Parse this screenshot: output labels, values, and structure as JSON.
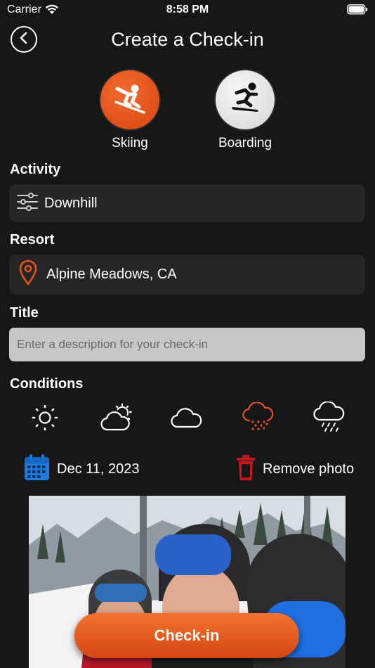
{
  "status": {
    "carrier": "Carrier",
    "time": "8:58 PM"
  },
  "nav": {
    "title": "Create a Check-in"
  },
  "sports": [
    {
      "label": "Skiing",
      "selected": true
    },
    {
      "label": "Boarding",
      "selected": false
    }
  ],
  "activity": {
    "label": "Activity",
    "value": "Downhill"
  },
  "resort": {
    "label": "Resort",
    "value": "Alpine Meadows, CA"
  },
  "title_field": {
    "label": "Title",
    "placeholder": "Enter a description for your check-in",
    "value": ""
  },
  "conditions": {
    "label": "Conditions",
    "options": [
      "sunny-icon",
      "partly-cloudy-icon",
      "cloudy-icon",
      "snow-icon",
      "rain-icon"
    ],
    "selected": "snow-icon"
  },
  "date": {
    "value": "Dec 11, 2023"
  },
  "remove_photo": {
    "label": "Remove photo"
  },
  "checkin_button": {
    "label": "Check-in"
  },
  "colors": {
    "accent": "#E5531A",
    "background": "#171717",
    "field": "#262626",
    "date_icon": "#1E7BE0",
    "trash_icon": "#C8161D"
  }
}
